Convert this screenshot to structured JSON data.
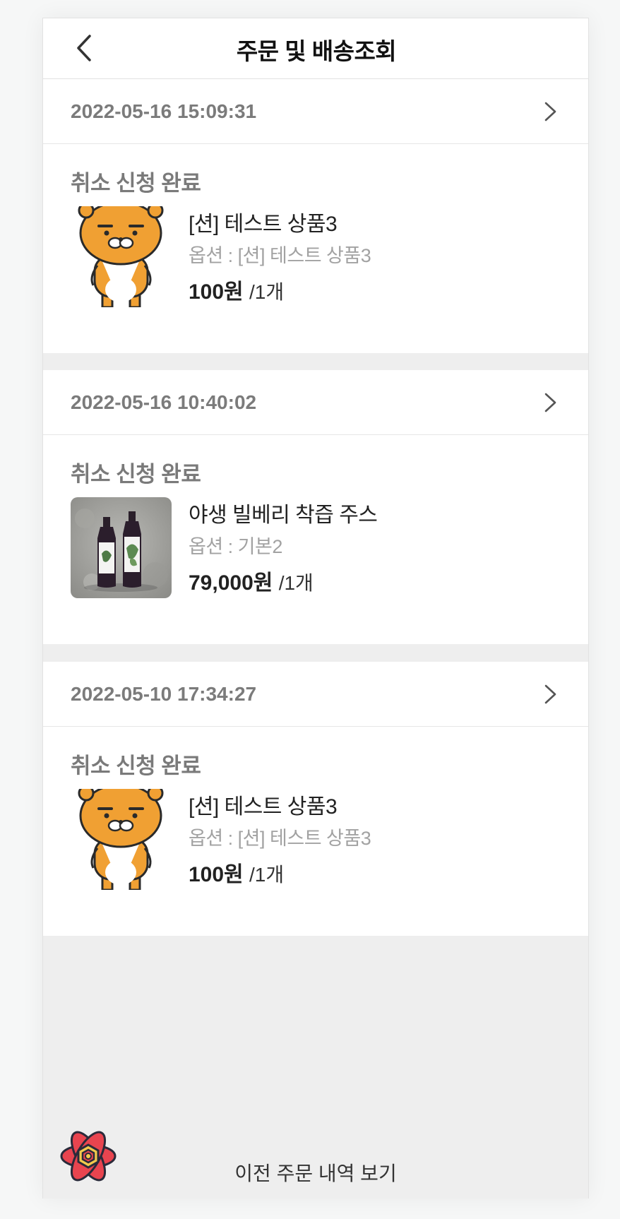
{
  "header": {
    "title": "주문 및 배송조회",
    "back_icon": "chevron-left-icon"
  },
  "orders": [
    {
      "date": "2022-05-16 15:09:31",
      "status": "취소 신청 완료",
      "product_name": "[션] 테스트 상품3",
      "option": "옵션 : [션] 테스트 상품3",
      "price": "100원",
      "quantity": "/1개",
      "thumb": "character-thumbnail"
    },
    {
      "date": "2022-05-16 10:40:02",
      "status": "취소 신청 완료",
      "product_name": "야생 빌베리 착즙 주스",
      "option": "옵션 : 기본2",
      "price": "79,000원",
      "quantity": "/1개",
      "thumb": "juice-bottles-photo"
    },
    {
      "date": "2022-05-10 17:34:27",
      "status": "취소 신청 완료",
      "product_name": "[션] 테스트 상품3",
      "option": "옵션 : [션] 테스트 상품3",
      "price": "100원",
      "quantity": "/1개",
      "thumb": "character-thumbnail"
    }
  ],
  "footer": {
    "previous_orders_label": "이전 주문 내역 보기"
  },
  "colors": {
    "accent_fab": "#e8444f",
    "character": "#f0a033"
  }
}
